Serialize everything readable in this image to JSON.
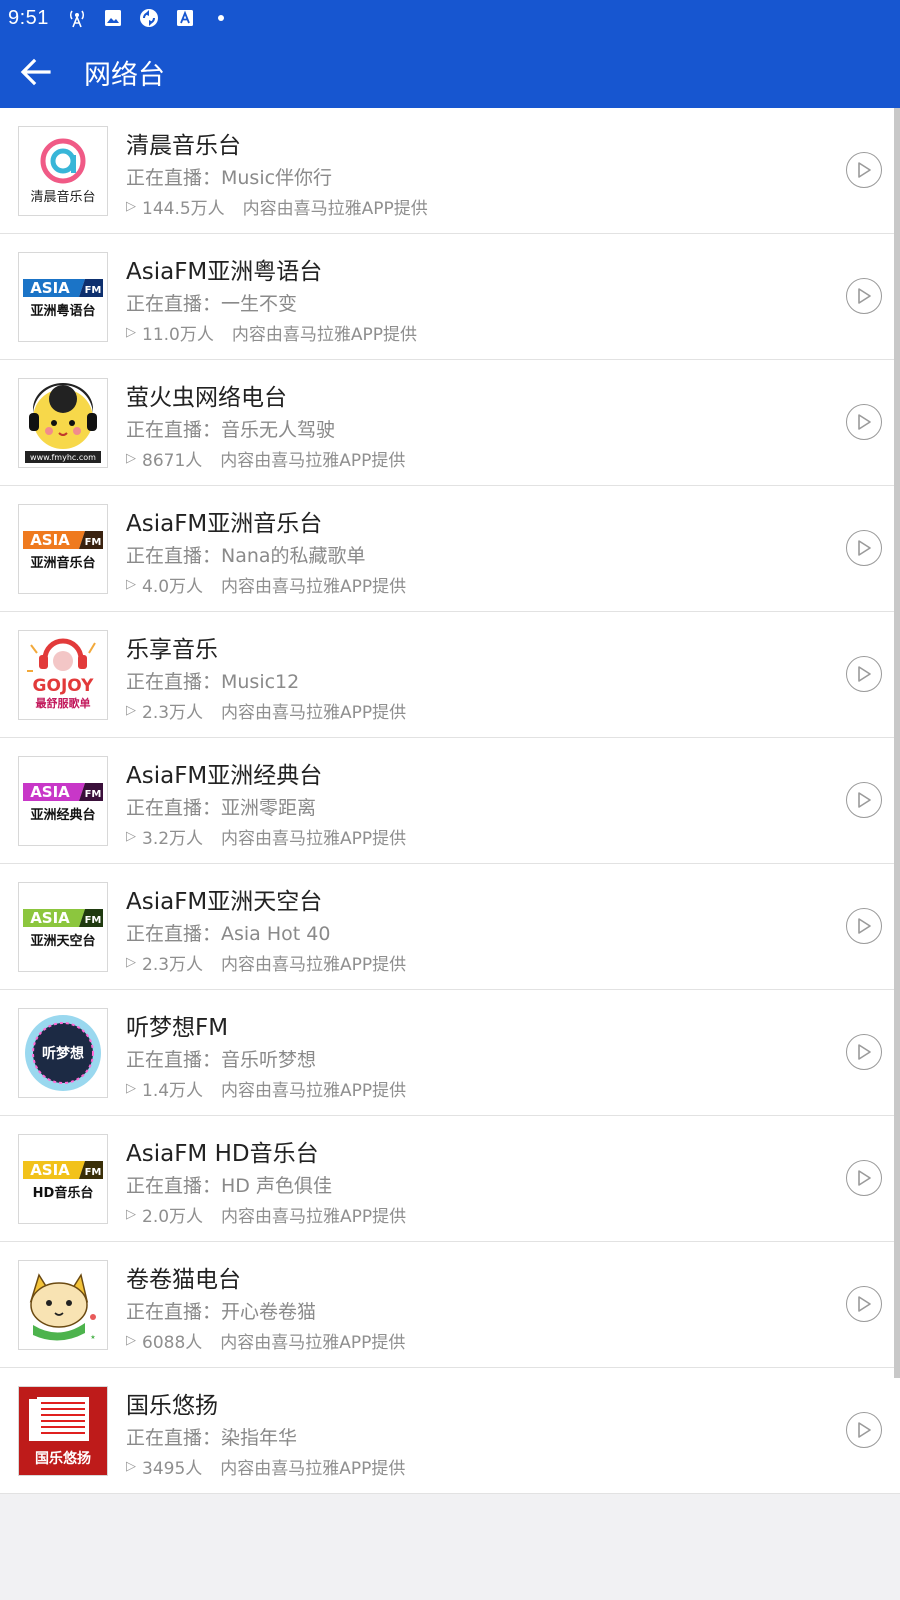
{
  "status_bar": {
    "time": "9:51",
    "icons": [
      "antenna-icon",
      "image-icon",
      "sync-icon",
      "font-icon",
      "notification-dot"
    ]
  },
  "toolbar": {
    "title": "网络台",
    "back_icon": "arrow-left-icon"
  },
  "colors": {
    "primary": "#1756d0",
    "text_primary": "#222222",
    "text_secondary": "#8a8a8a",
    "divider": "#e2e2e2"
  },
  "stations": [
    {
      "name": "清晨音乐台",
      "live": "正在直播：Music伴你行",
      "listeners": "144.5万人",
      "source": "内容由喜马拉雅APP提供",
      "logo": "qingchen"
    },
    {
      "name": "AsiaFM亚洲粤语台",
      "live": "正在直播：一生不变",
      "listeners": "11.0万人",
      "source": "内容由喜马拉雅APP提供",
      "logo": "asia-blue"
    },
    {
      "name": "萤火虫网络电台",
      "live": "正在直播：音乐无人驾驶",
      "listeners": "8671人",
      "source": "内容由喜马拉雅APP提供",
      "logo": "firefly"
    },
    {
      "name": "AsiaFM亚洲音乐台",
      "live": "正在直播：Nana的私藏歌单",
      "listeners": "4.0万人",
      "source": "内容由喜马拉雅APP提供",
      "logo": "asia-orange"
    },
    {
      "name": "乐享音乐",
      "live": "正在直播：Music12",
      "listeners": "2.3万人",
      "source": "内容由喜马拉雅APP提供",
      "logo": "gojoy"
    },
    {
      "name": "AsiaFM亚洲经典台",
      "live": "正在直播：亚洲零距离",
      "listeners": "3.2万人",
      "source": "内容由喜马拉雅APP提供",
      "logo": "asia-purple"
    },
    {
      "name": "AsiaFM亚洲天空台",
      "live": "正在直播：Asia Hot 40",
      "listeners": "2.3万人",
      "source": "内容由喜马拉雅APP提供",
      "logo": "asia-green"
    },
    {
      "name": "听梦想FM",
      "live": "正在直播：音乐听梦想",
      "listeners": "1.4万人",
      "source": "内容由喜马拉雅APP提供",
      "logo": "dream"
    },
    {
      "name": "AsiaFM HD音乐台",
      "live": "正在直播：HD 声色俱佳",
      "listeners": "2.0万人",
      "source": "内容由喜马拉雅APP提供",
      "logo": "asia-yellow"
    },
    {
      "name": "卷卷猫电台",
      "live": "正在直播：开心卷卷猫",
      "listeners": "6088人",
      "source": "内容由喜马拉雅APP提供",
      "logo": "cat"
    },
    {
      "name": "国乐悠扬",
      "live": "正在直播：染指年华",
      "listeners": "3495人",
      "source": "内容由喜马拉雅APP提供",
      "logo": "guoyue"
    }
  ],
  "logo_texts": {
    "qingchen": "清晨音乐台",
    "asia_word": "ASIA",
    "fm_word": "FM",
    "asia_blue_sub": "亚洲粤语台",
    "asia_orange_sub": "亚洲音乐台",
    "asia_purple_sub": "亚洲经典台",
    "asia_green_sub": "亚洲天空台",
    "asia_yellow_sub": "HD音乐台",
    "gojoy": "GOJOY",
    "gojoy_sub": "最舒服歌单",
    "dream": "听梦想",
    "guoyue": "国乐悠扬",
    "firefly_url": "www.fmyhc.com"
  }
}
